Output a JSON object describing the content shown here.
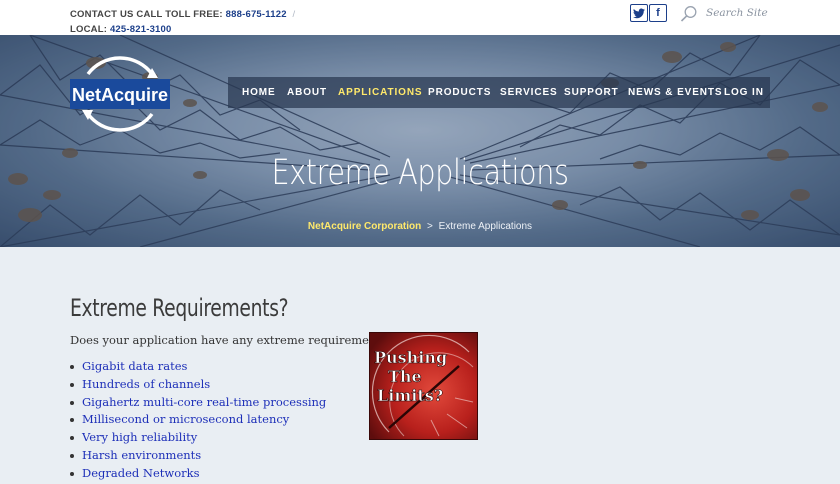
{
  "contact": {
    "tollfree_label": "CONTACT US CALL TOLL FREE:",
    "tollfree_number": "888-675-1122",
    "separator": "/",
    "local_label": "LOCAL:",
    "local_number": "425-821-3100"
  },
  "social": {
    "twitter": "t",
    "facebook": "f"
  },
  "search": {
    "placeholder": "Search Site"
  },
  "logo": {
    "text": "NetAcquire"
  },
  "nav": [
    {
      "label": "HOME"
    },
    {
      "label": "ABOUT"
    },
    {
      "label": "APPLICATIONS"
    },
    {
      "label": "PRODUCTS"
    },
    {
      "label": "SERVICES"
    },
    {
      "label": "SUPPORT"
    },
    {
      "label": "NEWS & EVENTS"
    },
    {
      "label": "LOG IN"
    }
  ],
  "hero": {
    "title": "Extreme Applications",
    "breadcrumb_home": "NetAcquire Corporation",
    "breadcrumb_sep": ">",
    "breadcrumb_current": "Extreme Applications"
  },
  "main": {
    "heading": "Extreme Requirements?",
    "intro": "Does your application have any extreme requirements:",
    "items": [
      "Gigabit data rates",
      "Hundreds of channels",
      "Gigahertz multi-core real-time processing",
      "Millisecond or microsecond latency",
      "Very high reliability",
      "Harsh environments",
      "Degraded Networks"
    ],
    "badge_lines": [
      "Pushing",
      "The",
      "Limits?"
    ]
  },
  "colors": {
    "accent": "#1c3f8a",
    "nav_active": "#ffe96b",
    "link": "#1d2fb8"
  }
}
